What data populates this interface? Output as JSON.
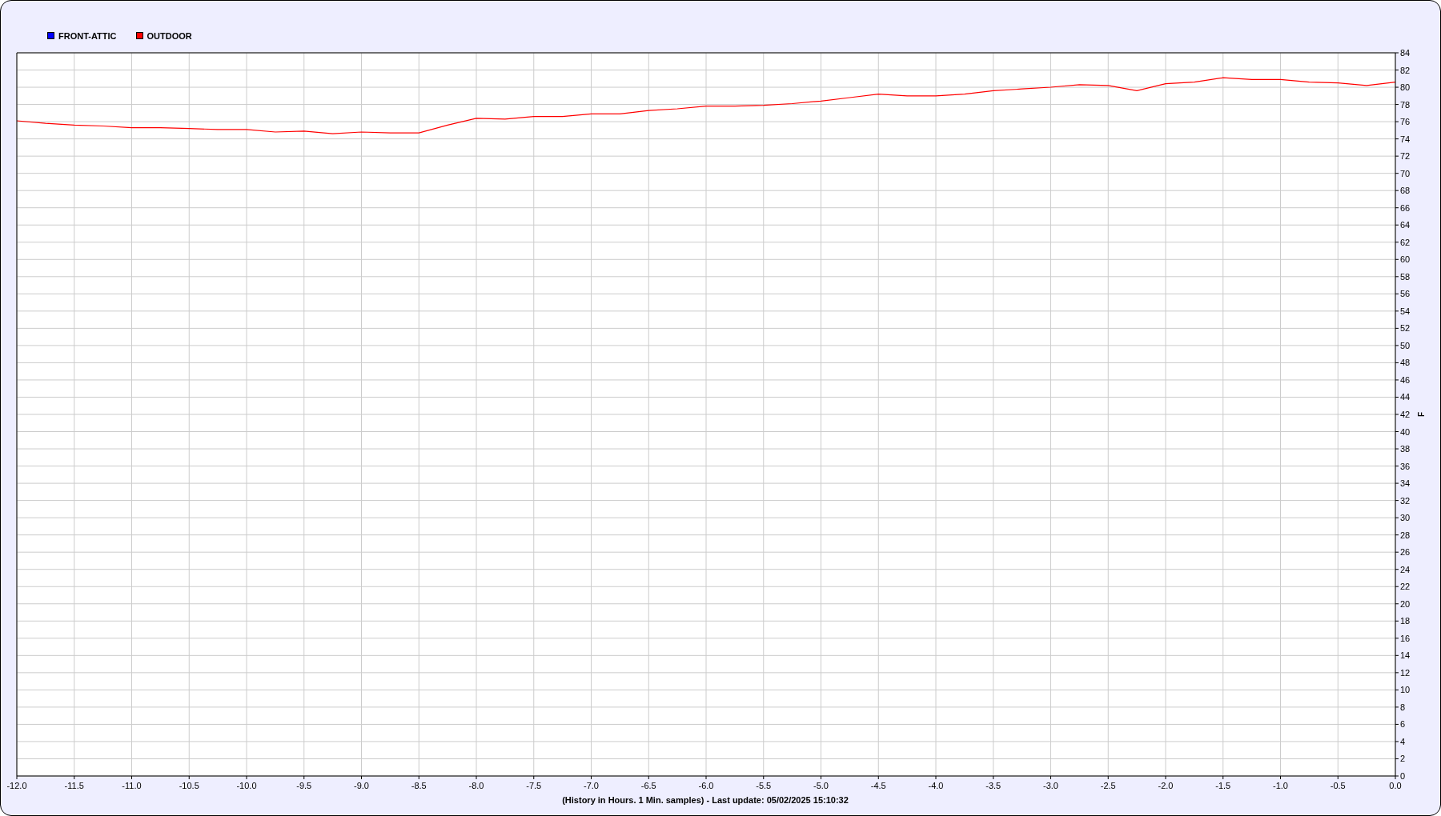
{
  "chart_data": {
    "type": "line",
    "grid": true,
    "xlabel": "(History in Hours. 1 Min. samples) - Last update: 05/02/2025 15:10:32",
    "ylabel": "F",
    "x": [
      -12.0,
      -11.75,
      -11.5,
      -11.25,
      -11.0,
      -10.75,
      -10.5,
      -10.25,
      -10.0,
      -9.75,
      -9.5,
      -9.25,
      -9.0,
      -8.75,
      -8.5,
      -8.25,
      -8.0,
      -7.75,
      -7.5,
      -7.25,
      -7.0,
      -6.75,
      -6.5,
      -6.25,
      -6.0,
      -5.75,
      -5.5,
      -5.25,
      -5.0,
      -4.75,
      -4.5,
      -4.25,
      -4.0,
      -3.75,
      -3.5,
      -3.25,
      -3.0,
      -2.75,
      -2.5,
      -2.25,
      -2.0,
      -1.75,
      -1.5,
      -1.25,
      -1.0,
      -0.75,
      -0.5,
      -0.25,
      0.0
    ],
    "series": [
      {
        "name": "FRONT-ATTIC",
        "color": "#0000ff",
        "values": [
          null,
          null,
          null,
          null,
          null,
          null,
          null,
          null,
          null,
          null,
          null,
          null,
          null,
          null,
          null,
          null,
          null,
          null,
          null,
          null,
          null,
          null,
          null,
          null,
          null,
          null,
          null,
          null,
          null,
          null,
          null,
          null,
          null,
          null,
          null,
          null,
          null,
          null,
          null,
          null,
          null,
          null,
          null,
          null,
          null,
          null,
          null,
          null,
          null
        ]
      },
      {
        "name": "OUTDOOR",
        "color": "#ff0000",
        "values": [
          76.1,
          75.8,
          75.6,
          75.5,
          75.3,
          75.3,
          75.2,
          75.1,
          75.1,
          74.8,
          74.9,
          74.6,
          74.8,
          74.7,
          74.7,
          75.6,
          76.4,
          76.3,
          76.6,
          76.6,
          76.9,
          76.9,
          77.3,
          77.5,
          77.8,
          77.8,
          77.9,
          78.1,
          78.4,
          78.8,
          79.2,
          79.0,
          79.0,
          79.2,
          79.6,
          79.8,
          80.0,
          80.3,
          80.2,
          79.6,
          80.4,
          80.6,
          81.1,
          80.9,
          80.9,
          80.6,
          80.5,
          80.2,
          80.6
        ]
      }
    ],
    "xlim": [
      -12,
      0
    ],
    "ylim": [
      0,
      84
    ],
    "xticks": [
      {
        "value": -12,
        "label": "-12.0"
      },
      {
        "value": -11.5,
        "label": "-11.5"
      },
      {
        "value": -11,
        "label": "-11.0"
      },
      {
        "value": -10.5,
        "label": "-10.5"
      },
      {
        "value": -10,
        "label": "-10.0"
      },
      {
        "value": -9.5,
        "label": "-9.5"
      },
      {
        "value": -9,
        "label": "-9.0"
      },
      {
        "value": -8.5,
        "label": "-8.5"
      },
      {
        "value": -8,
        "label": "-8.0"
      },
      {
        "value": -7.5,
        "label": "-7.5"
      },
      {
        "value": -7,
        "label": "-7.0"
      },
      {
        "value": -6.5,
        "label": "-6.5"
      },
      {
        "value": -6,
        "label": "-6.0"
      },
      {
        "value": -5.5,
        "label": "-5.5"
      },
      {
        "value": -5,
        "label": "-5.0"
      },
      {
        "value": -4.5,
        "label": "-4.5"
      },
      {
        "value": -4,
        "label": "-4.0"
      },
      {
        "value": -3.5,
        "label": "-3.5"
      },
      {
        "value": -3,
        "label": "-3.0"
      },
      {
        "value": -2.5,
        "label": "-2.5"
      },
      {
        "value": -2,
        "label": "-2.0"
      },
      {
        "value": -1.5,
        "label": "-1.5"
      },
      {
        "value": -1,
        "label": "-1.0"
      },
      {
        "value": -0.5,
        "label": "-0.5"
      },
      {
        "value": 0,
        "label": "0.0"
      }
    ],
    "yticks": [
      0,
      2,
      4,
      6,
      8,
      10,
      12,
      14,
      16,
      18,
      20,
      22,
      24,
      26,
      28,
      30,
      32,
      34,
      36,
      38,
      40,
      42,
      44,
      46,
      48,
      50,
      52,
      54,
      56,
      58,
      60,
      62,
      64,
      66,
      68,
      70,
      72,
      74,
      76,
      78,
      80,
      82,
      84
    ]
  }
}
